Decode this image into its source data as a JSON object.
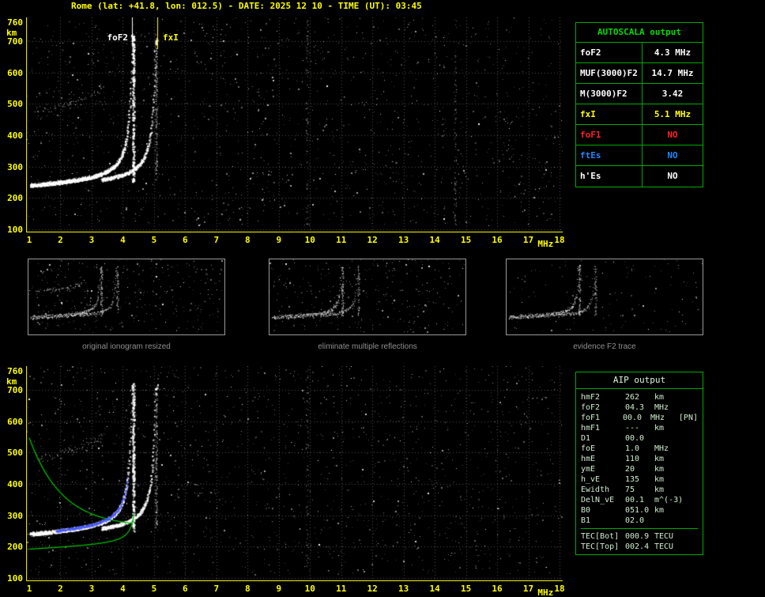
{
  "title": "Rome (lat: +41.8, lon: 012.5) - DATE: 2025 12 10 - TIME (UT): 03:45",
  "ionogram": {
    "x_unit": "MHz",
    "y_unit": "km",
    "x_min": 1,
    "x_max": 18,
    "x_ticks": [
      1,
      2,
      3,
      4,
      5,
      6,
      7,
      8,
      9,
      10,
      11,
      12,
      13,
      14,
      15,
      16,
      17,
      18
    ],
    "y_ticks": [
      760,
      700,
      600,
      500,
      400,
      300,
      200,
      100
    ],
    "km_min": 100,
    "km_max": 760,
    "foF2_mhz": 4.3,
    "fxI_mhz": 5.1,
    "foF2_label": "foF2",
    "fxI_label": "fxI"
  },
  "autoscala": {
    "header": "AUTOSCALA output",
    "rows": [
      {
        "label": "foF2",
        "value": "4.3 MHz",
        "color": "#ffffff"
      },
      {
        "label": "MUF(3000)F2",
        "value": "14.7 MHz",
        "color": "#ffffff"
      },
      {
        "label": "M(3000)F2",
        "value": "3.42",
        "color": "#ffffff"
      },
      {
        "label": "fxI",
        "value": "5.1 MHz",
        "color": "#ffff00"
      },
      {
        "label": "foF1",
        "value": "NO",
        "color": "#ff2222"
      },
      {
        "label": "ftEs",
        "value": "NO",
        "color": "#2288ff"
      },
      {
        "label": "h'Es",
        "value": "NO",
        "color": "#ffffff"
      }
    ]
  },
  "thumbnails": [
    {
      "caption": "original ionogram resized"
    },
    {
      "caption": "eliminate multiple reflections"
    },
    {
      "caption": "evidence F2 trace"
    }
  ],
  "aip": {
    "header": "AIP output",
    "rows": [
      {
        "name": "hmF2",
        "value": "262",
        "unit": "km",
        "note": ""
      },
      {
        "name": "foF2",
        "value": "04.3",
        "unit": "MHz",
        "note": ""
      },
      {
        "name": "foF1",
        "value": "00.0",
        "unit": "MHz",
        "note": "[PN]"
      },
      {
        "name": "hmF1",
        "value": "---",
        "unit": "km",
        "note": ""
      },
      {
        "name": "D1",
        "value": "00.0",
        "unit": "",
        "note": ""
      },
      {
        "name": "foE",
        "value": "1.0",
        "unit": "MHz",
        "note": ""
      },
      {
        "name": "hmE",
        "value": "110",
        "unit": "km",
        "note": ""
      },
      {
        "name": "ymE",
        "value": "20",
        "unit": "km",
        "note": ""
      },
      {
        "name": "h_vE",
        "value": "135",
        "unit": "km",
        "note": ""
      },
      {
        "name": "Ewidth",
        "value": "75",
        "unit": "km",
        "note": ""
      },
      {
        "name": "DelN_vE",
        "value": "00.1",
        "unit": "m^(-3)",
        "note": ""
      },
      {
        "name": "B0",
        "value": "051.0",
        "unit": "km",
        "note": ""
      },
      {
        "name": "B1",
        "value": "02.0",
        "unit": "",
        "note": ""
      },
      {
        "name": "TEC[Bot]",
        "value": "000.9",
        "unit": "TECU",
        "note": "",
        "sep": true
      },
      {
        "name": "TEC[Top]",
        "value": "002.4",
        "unit": "TECU",
        "note": ""
      }
    ]
  },
  "colors": {
    "accent": "#ffff00",
    "table_border": "#00aa00",
    "header_green": "#00dd00",
    "profile_green": "#00bb00",
    "trace_blue": "#4455ff",
    "grid": "#4f4f4f"
  }
}
